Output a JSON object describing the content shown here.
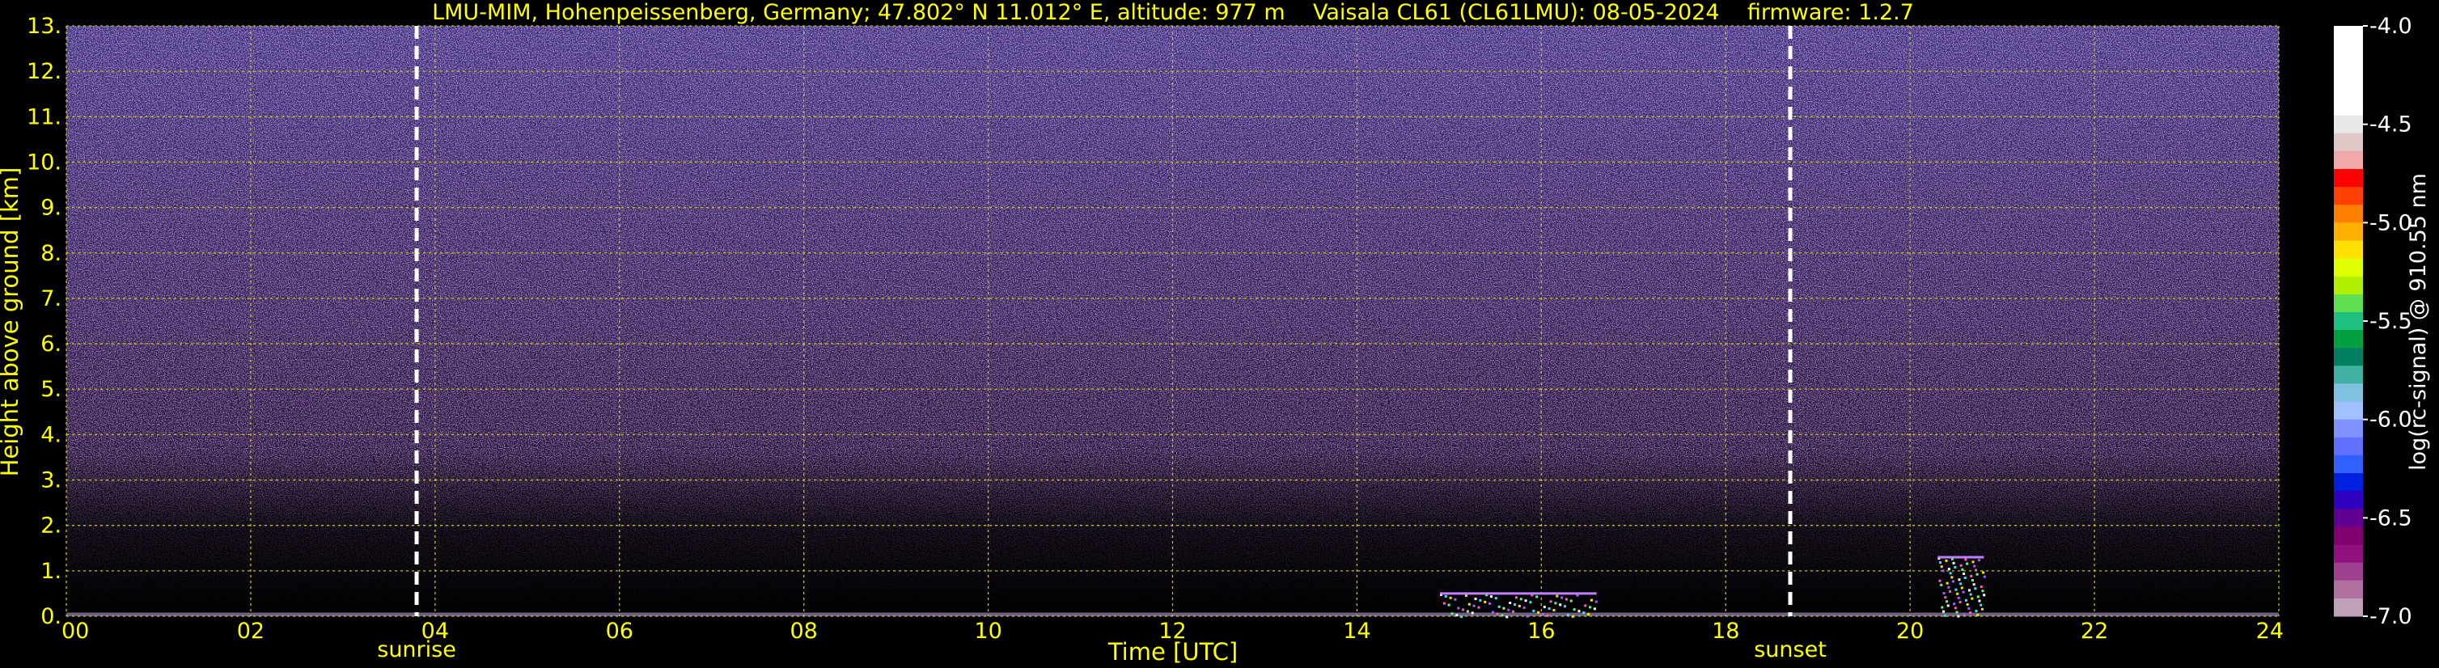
{
  "chart_data": {
    "type": "heatmap",
    "title": "LMU-MIM, Hohenpeissenberg, Germany; 47.802° N 11.012° E, altitude: 977 m    Vaisala CL61 (CL61LMU): 08-05-2024    firmware: 1.2.7",
    "xlabel": "Time [UTC]",
    "ylabel": "Height above ground [km]",
    "colorbar_label": "log(rc-signal) @ 910.55 nm",
    "xlim": [
      0,
      24
    ],
    "ylim": [
      0,
      13
    ],
    "x_ticks": [
      "00",
      "02",
      "04",
      "06",
      "08",
      "10",
      "12",
      "14",
      "16",
      "18",
      "20",
      "22",
      "24"
    ],
    "y_ticks": [
      "0.",
      "1.",
      "2.",
      "3.",
      "4.",
      "5.",
      "6.",
      "7.",
      "8.",
      "9.",
      "10.",
      "11.",
      "12.",
      "13."
    ],
    "colorbar_range": [
      -7.0,
      -4.0
    ],
    "colorbar_ticks": [
      "-4.0",
      "-4.5",
      "-5.0",
      "-5.5",
      "-6.0",
      "-6.5",
      "-7.0"
    ],
    "grid": true,
    "markers": [
      {
        "label": "sunrise",
        "time": 3.8
      },
      {
        "label": "sunset",
        "time": 18.7
      }
    ],
    "features": [
      {
        "time_start": 20.3,
        "time_end": 20.8,
        "height_km": 1.3
      },
      {
        "time_start": 14.9,
        "time_end": 16.6,
        "height_km": 0.5
      }
    ],
    "colors": {
      "background": "#000000",
      "text": "#ffff00",
      "grid": "#c8c800",
      "marker": "#ffffff",
      "noise": "#8050d0"
    },
    "colorbar_colors": [
      "#ffffff",
      "#ffffff",
      "#ffffff",
      "#ffffff",
      "#ffffff",
      "#e8e8e8",
      "#e0c8c8",
      "#f0a8a8",
      "#ff0000",
      "#ff4000",
      "#ff8000",
      "#ffb000",
      "#ffe000",
      "#e0ff00",
      "#b0f000",
      "#60e050",
      "#20c080",
      "#00a040",
      "#008060",
      "#40b0a0",
      "#80c0e0",
      "#a0c0ff",
      "#8090ff",
      "#6070ff",
      "#3060ff",
      "#0020e0",
      "#3000c0",
      "#600090",
      "#800070",
      "#901080",
      "#a04090",
      "#b070a0",
      "#c0a0b8"
    ]
  }
}
